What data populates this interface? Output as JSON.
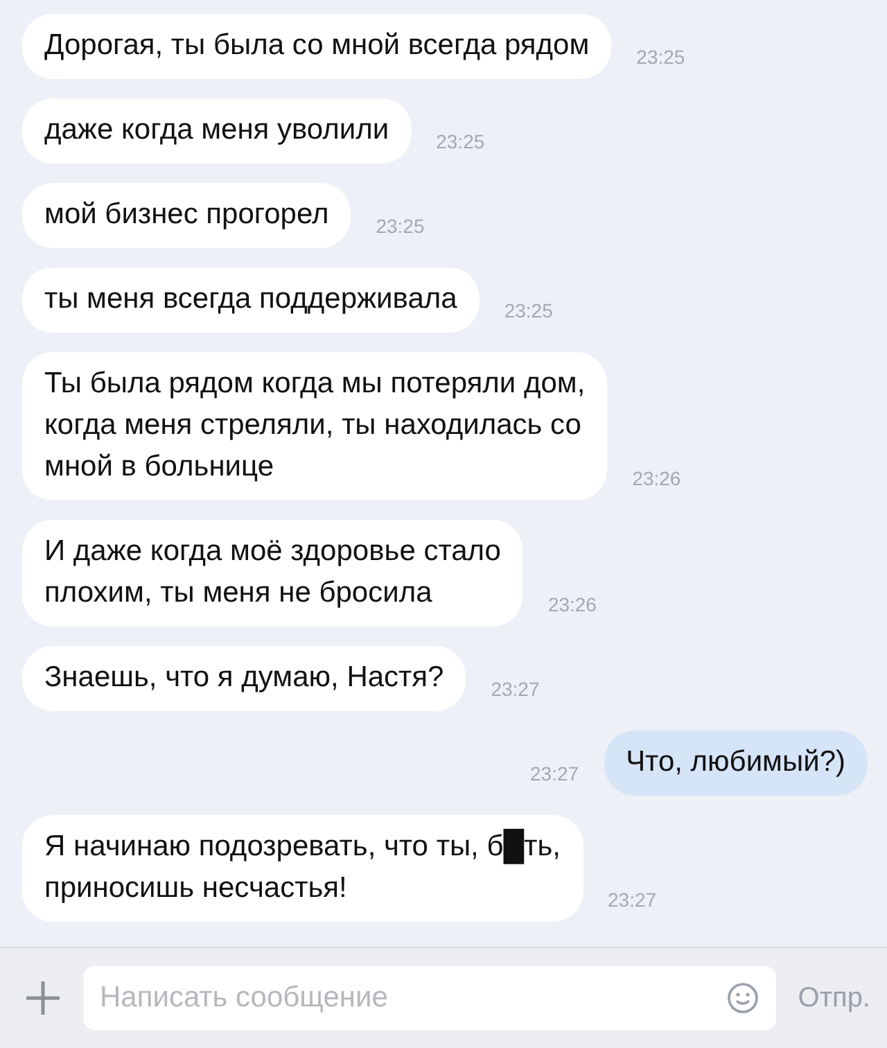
{
  "messages": [
    {
      "kind": "incoming",
      "text": "Дорогая, ты была со мной всегда рядом",
      "time": "23:25"
    },
    {
      "kind": "incoming",
      "text": "даже когда меня уволили",
      "time": "23:25"
    },
    {
      "kind": "incoming",
      "text": "мой бизнес прогорел",
      "time": "23:25"
    },
    {
      "kind": "incoming",
      "text": "ты меня всегда поддерживала",
      "time": "23:25"
    },
    {
      "kind": "incoming",
      "text": "Ты была рядом когда мы потеряли дом,\nкогда меня стреляли, ты находилась со\nмной в больнице",
      "time": "23:26"
    },
    {
      "kind": "incoming",
      "text": "И даже когда моё здоровье стало\nплохим, ты меня не бросила",
      "time": "23:26"
    },
    {
      "kind": "incoming",
      "text": "Знаешь, что я думаю, Настя?",
      "time": "23:27"
    },
    {
      "kind": "outgoing",
      "text": "Что, любимый?)",
      "time": "23:27"
    },
    {
      "kind": "incoming",
      "text": "Я начинаю подозревать, что ты, б█ть,\nприносишь несчастья!",
      "time": "23:27"
    }
  ],
  "composer": {
    "placeholder": "Написать сообщение",
    "send": "Отпр."
  }
}
